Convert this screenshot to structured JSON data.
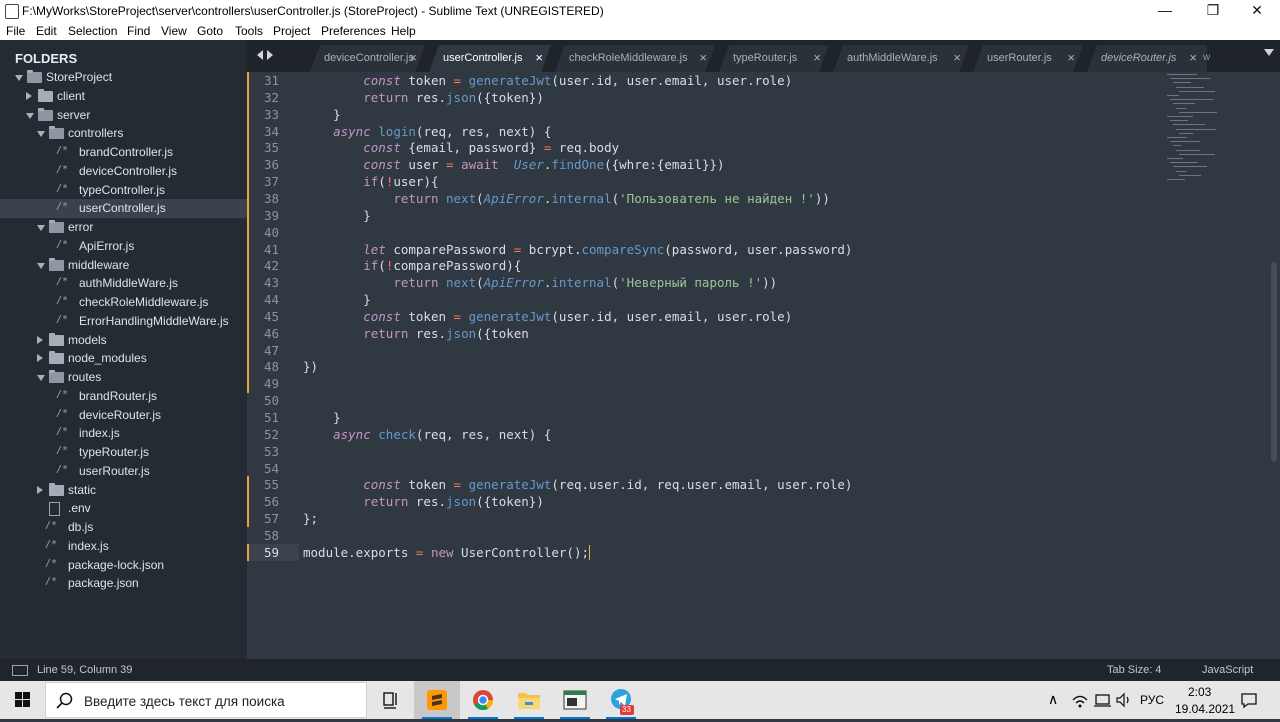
{
  "window": {
    "title": "F:\\MyWorks\\StoreProject\\server\\controllers\\userController.js (StoreProject) - Sublime Text (UNREGISTERED)",
    "minimize_glyph": "—",
    "maximize_glyph": "❐",
    "close_glyph": "✕"
  },
  "menu": [
    "File",
    "Edit",
    "Selection",
    "Find",
    "View",
    "Goto",
    "Tools",
    "Project",
    "Preferences",
    "Help"
  ],
  "sidebar": {
    "title": "FOLDERS",
    "tree": [
      {
        "label": "StoreProject",
        "type": "folder-open"
      },
      {
        "label": "client",
        "type": "folder-closed"
      },
      {
        "label": "server",
        "type": "folder-open"
      },
      {
        "label": "controllers",
        "type": "folder-open"
      },
      {
        "label": "brandController.js",
        "type": "js-file"
      },
      {
        "label": "deviceController.js",
        "type": "js-file"
      },
      {
        "label": "typeController.js",
        "type": "js-file"
      },
      {
        "label": "userController.js",
        "type": "js-file",
        "selected": true
      },
      {
        "label": "error",
        "type": "folder-open"
      },
      {
        "label": "ApiError.js",
        "type": "js-file"
      },
      {
        "label": "middleware",
        "type": "folder-open"
      },
      {
        "label": "authMiddleWare.js",
        "type": "js-file"
      },
      {
        "label": "checkRoleMiddleware.js",
        "type": "js-file"
      },
      {
        "label": "ErrorHandlingMiddleWare.js",
        "type": "js-file"
      },
      {
        "label": "models",
        "type": "folder-closed"
      },
      {
        "label": "node_modules",
        "type": "folder-closed"
      },
      {
        "label": "routes",
        "type": "folder-open"
      },
      {
        "label": "brandRouter.js",
        "type": "js-file"
      },
      {
        "label": "deviceRouter.js",
        "type": "js-file"
      },
      {
        "label": "index.js",
        "type": "js-file"
      },
      {
        "label": "typeRouter.js",
        "type": "js-file"
      },
      {
        "label": "userRouter.js",
        "type": "js-file"
      },
      {
        "label": "static",
        "type": "folder-closed"
      },
      {
        "label": ".env",
        "type": "plain-file"
      },
      {
        "label": "db.js",
        "type": "js-file"
      },
      {
        "label": "index.js",
        "type": "js-file"
      },
      {
        "label": "package-lock.json",
        "type": "js-file"
      },
      {
        "label": "package.json",
        "type": "js-file"
      }
    ],
    "file_glyph": "/*"
  },
  "tabs": [
    {
      "label": "deviceController.js",
      "active": false,
      "italic": false
    },
    {
      "label": "userController.js",
      "active": true,
      "italic": false
    },
    {
      "label": "checkRoleMiddleware.js",
      "active": false,
      "italic": false
    },
    {
      "label": "typeRouter.js",
      "active": false,
      "italic": false
    },
    {
      "label": "authMiddleWare.js",
      "active": false,
      "italic": false
    },
    {
      "label": "userRouter.js",
      "active": false,
      "italic": false
    },
    {
      "label": "deviceRouter.js",
      "active": false,
      "italic": true
    }
  ],
  "tab_close_glyph": "×",
  "tab_overflow_label": "w",
  "editor": {
    "current_line": 59,
    "modified_lines": [
      31,
      32,
      33,
      34,
      35,
      36,
      37,
      38,
      39,
      40,
      41,
      42,
      43,
      44,
      45,
      46,
      47,
      48,
      49,
      55,
      56,
      57,
      59
    ],
    "lines": [
      {
        "n": "31",
        "tokens": [
          [
            "        ",
            "p"
          ],
          [
            "const",
            "k"
          ],
          [
            " token ",
            "p"
          ],
          [
            "=",
            "o"
          ],
          [
            " ",
            "p"
          ],
          [
            "generateJwt",
            "f"
          ],
          [
            "(user.id, user.email, user.role)",
            "p"
          ]
        ]
      },
      {
        "n": "32",
        "tokens": [
          [
            "        ",
            "p"
          ],
          [
            "return",
            "k2"
          ],
          [
            " res.",
            "p"
          ],
          [
            "json",
            "f"
          ],
          [
            "({token})",
            "p"
          ]
        ]
      },
      {
        "n": "33",
        "tokens": [
          [
            "    }",
            "p"
          ]
        ]
      },
      {
        "n": "34",
        "tokens": [
          [
            "    ",
            "p"
          ],
          [
            "async",
            "k"
          ],
          [
            " ",
            "p"
          ],
          [
            "login",
            "f"
          ],
          [
            "(req, res, next) {",
            "p"
          ]
        ]
      },
      {
        "n": "35",
        "tokens": [
          [
            "        ",
            "p"
          ],
          [
            "const",
            "k"
          ],
          [
            " {email, password} ",
            "p"
          ],
          [
            "=",
            "o"
          ],
          [
            " req.body",
            "p"
          ]
        ]
      },
      {
        "n": "36",
        "tokens": [
          [
            "        ",
            "p"
          ],
          [
            "const",
            "k"
          ],
          [
            " user ",
            "p"
          ],
          [
            "=",
            "o"
          ],
          [
            " ",
            "p"
          ],
          [
            "await",
            "k2"
          ],
          [
            "  ",
            "p"
          ],
          [
            "User",
            "c"
          ],
          [
            ".",
            "p"
          ],
          [
            "findOne",
            "f"
          ],
          [
            "({whre:{email}})",
            "p"
          ]
        ]
      },
      {
        "n": "37",
        "tokens": [
          [
            "        ",
            "p"
          ],
          [
            "if",
            "k2"
          ],
          [
            "(",
            "p"
          ],
          [
            "!",
            "o"
          ],
          [
            "user){",
            "p"
          ]
        ]
      },
      {
        "n": "38",
        "tokens": [
          [
            "            ",
            "p"
          ],
          [
            "return",
            "k2"
          ],
          [
            " ",
            "p"
          ],
          [
            "next",
            "f"
          ],
          [
            "(",
            "p"
          ],
          [
            "ApiError",
            "c"
          ],
          [
            ".",
            "p"
          ],
          [
            "internal",
            "f"
          ],
          [
            "(",
            "p"
          ],
          [
            "'Пользователь не найден !'",
            "s"
          ],
          [
            "))",
            "p"
          ]
        ]
      },
      {
        "n": "39",
        "tokens": [
          [
            "        }",
            "p"
          ]
        ]
      },
      {
        "n": "40",
        "tokens": []
      },
      {
        "n": "41",
        "tokens": [
          [
            "        ",
            "p"
          ],
          [
            "let",
            "k"
          ],
          [
            " comparePassword ",
            "p"
          ],
          [
            "=",
            "o"
          ],
          [
            " bcrypt.",
            "p"
          ],
          [
            "compareSync",
            "f"
          ],
          [
            "(password, user.password)",
            "p"
          ]
        ]
      },
      {
        "n": "42",
        "tokens": [
          [
            "        ",
            "p"
          ],
          [
            "if",
            "k2"
          ],
          [
            "(",
            "p"
          ],
          [
            "!",
            "o"
          ],
          [
            "comparePassword){",
            "p"
          ]
        ]
      },
      {
        "n": "43",
        "tokens": [
          [
            "            ",
            "p"
          ],
          [
            "return",
            "k2"
          ],
          [
            " ",
            "p"
          ],
          [
            "next",
            "f"
          ],
          [
            "(",
            "p"
          ],
          [
            "ApiError",
            "c"
          ],
          [
            ".",
            "p"
          ],
          [
            "internal",
            "f"
          ],
          [
            "(",
            "p"
          ],
          [
            "'Неверный пароль !'",
            "s"
          ],
          [
            "))",
            "p"
          ]
        ]
      },
      {
        "n": "44",
        "tokens": [
          [
            "        }",
            "p"
          ]
        ]
      },
      {
        "n": "45",
        "tokens": [
          [
            "        ",
            "p"
          ],
          [
            "const",
            "k"
          ],
          [
            " token ",
            "p"
          ],
          [
            "=",
            "o"
          ],
          [
            " ",
            "p"
          ],
          [
            "generateJwt",
            "f"
          ],
          [
            "(user.id, user.email, user.role)",
            "p"
          ]
        ]
      },
      {
        "n": "46",
        "tokens": [
          [
            "        ",
            "p"
          ],
          [
            "return",
            "k2"
          ],
          [
            " res.",
            "p"
          ],
          [
            "json",
            "f"
          ],
          [
            "({token",
            "p"
          ]
        ]
      },
      {
        "n": "47",
        "tokens": []
      },
      {
        "n": "48",
        "tokens": [
          [
            "})",
            "p"
          ]
        ]
      },
      {
        "n": "49",
        "tokens": []
      },
      {
        "n": "50",
        "tokens": []
      },
      {
        "n": "51",
        "tokens": [
          [
            "    }",
            "p"
          ]
        ]
      },
      {
        "n": "52",
        "tokens": [
          [
            "    ",
            "p"
          ],
          [
            "async",
            "k"
          ],
          [
            " ",
            "p"
          ],
          [
            "check",
            "f"
          ],
          [
            "(req, res, next) {",
            "p"
          ]
        ]
      },
      {
        "n": "53",
        "tokens": []
      },
      {
        "n": "54",
        "tokens": []
      },
      {
        "n": "55",
        "tokens": [
          [
            "        ",
            "p"
          ],
          [
            "const",
            "k"
          ],
          [
            " token ",
            "p"
          ],
          [
            "=",
            "o"
          ],
          [
            " ",
            "p"
          ],
          [
            "generateJwt",
            "f"
          ],
          [
            "(req.user.id, req.user.email, user.role)",
            "p"
          ]
        ]
      },
      {
        "n": "56",
        "tokens": [
          [
            "        ",
            "p"
          ],
          [
            "return",
            "k2"
          ],
          [
            " res.",
            "p"
          ],
          [
            "json",
            "f"
          ],
          [
            "({token})",
            "p"
          ]
        ]
      },
      {
        "n": "57",
        "tokens": [
          [
            "};",
            "p"
          ]
        ]
      },
      {
        "n": "58",
        "tokens": []
      },
      {
        "n": "59",
        "tokens": [
          [
            "module.exports ",
            "p"
          ],
          [
            "=",
            "o"
          ],
          [
            " ",
            "p"
          ],
          [
            "new",
            "k2"
          ],
          [
            " UserController();",
            "p"
          ]
        ]
      }
    ]
  },
  "statusbar": {
    "position": "Line 59, Column 39",
    "tab_size": "Tab Size: 4",
    "syntax": "JavaScript"
  },
  "taskbar": {
    "search_placeholder": "Введите здесь текст для поиска",
    "language": "РУС",
    "time": "2:03",
    "date": "19.04.2021",
    "telegram_badge": "33",
    "tray_chevron": "∧"
  },
  "colors": {
    "editor_bg": "#303841",
    "sidebar_bg": "#252b32",
    "keyword": "#c594c5",
    "function": "#6699cc",
    "operator": "#f97b58",
    "string": "#99c794",
    "gutter_modified": "#e8a33d"
  },
  "icons": [
    "windows-start-icon",
    "search-icon",
    "task-view-icon",
    "sublime-text-icon",
    "chrome-icon",
    "file-explorer-icon",
    "terminal-app-icon",
    "telegram-icon",
    "network-icon",
    "volume-icon",
    "notification-icon"
  ]
}
